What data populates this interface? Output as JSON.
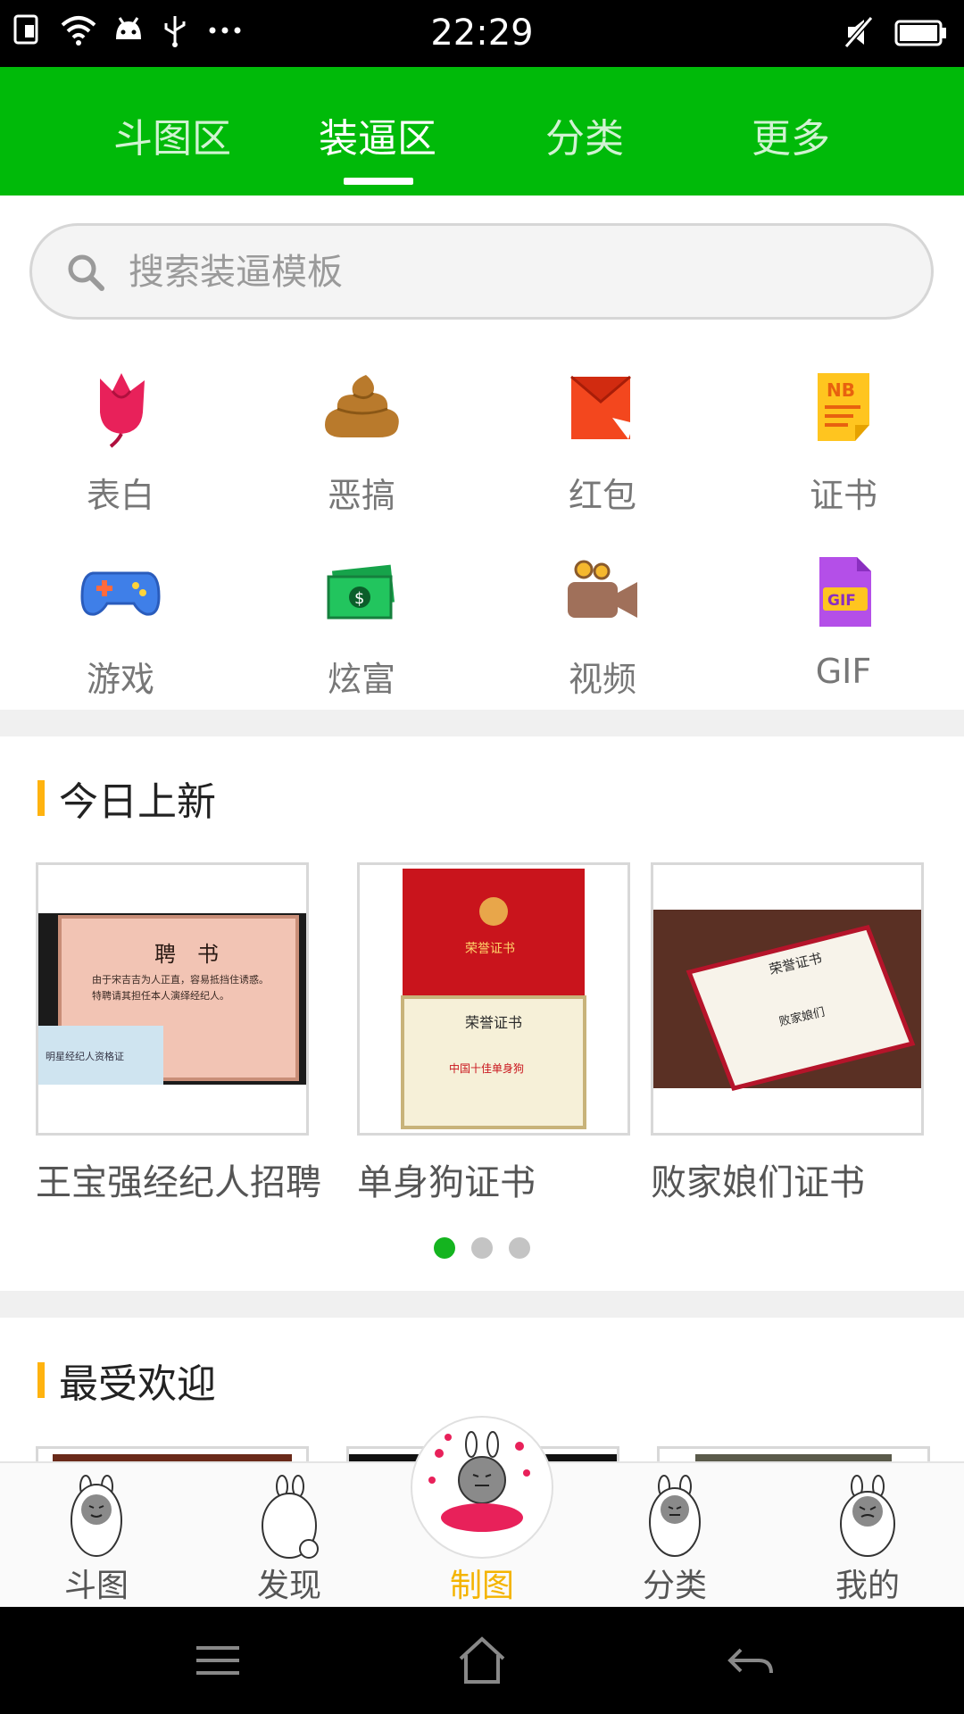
{
  "status_bar": {
    "time": "22:29"
  },
  "top_tabs": {
    "tabs": [
      {
        "label": "斗图区"
      },
      {
        "label": "装逼区"
      },
      {
        "label": "分类"
      },
      {
        "label": "更多"
      }
    ],
    "active_index": 1
  },
  "search": {
    "placeholder": "搜索装逼模板"
  },
  "categories": [
    {
      "label": "表白",
      "icon": "rose-icon"
    },
    {
      "label": "恶搞",
      "icon": "poop-icon"
    },
    {
      "label": "红包",
      "icon": "red-envelope-icon"
    },
    {
      "label": "证书",
      "icon": "nb-certificate-icon"
    },
    {
      "label": "游戏",
      "icon": "gamepad-icon"
    },
    {
      "label": "炫富",
      "icon": "money-icon"
    },
    {
      "label": "视频",
      "icon": "video-camera-icon"
    },
    {
      "label": "GIF",
      "icon": "gif-file-icon"
    }
  ],
  "today_new": {
    "title": "今日上新",
    "cards": [
      {
        "title": "王宝强经纪人招聘",
        "image_text": {
          "heading": "聘　书",
          "line1": "由于宋吉吉为人正直，容易抵挡住诱惑。",
          "line2": "特聘请其担任本人演绎经纪人。",
          "badge": "明星经纪人资格证"
        }
      },
      {
        "title": "单身狗证书",
        "image_text": {
          "cover": "荣誉证书",
          "heading": "荣誉证书",
          "line": "中国十佳单身狗"
        }
      },
      {
        "title": "败家娘们证书",
        "image_text": {
          "heading": "荣誉证书",
          "line": "败家娘们"
        }
      }
    ],
    "page_count": 3,
    "active_page": 0
  },
  "most_popular": {
    "title": "最受欢迎"
  },
  "bottom_nav": {
    "items": [
      {
        "label": "斗图"
      },
      {
        "label": "发现"
      },
      {
        "label": "制图"
      },
      {
        "label": "分类"
      },
      {
        "label": "我的"
      }
    ],
    "active_index": 2
  },
  "colors": {
    "brand_green": "#00ba09",
    "accent_yellow": "#ffb30f",
    "active_nav": "#f4b400"
  }
}
